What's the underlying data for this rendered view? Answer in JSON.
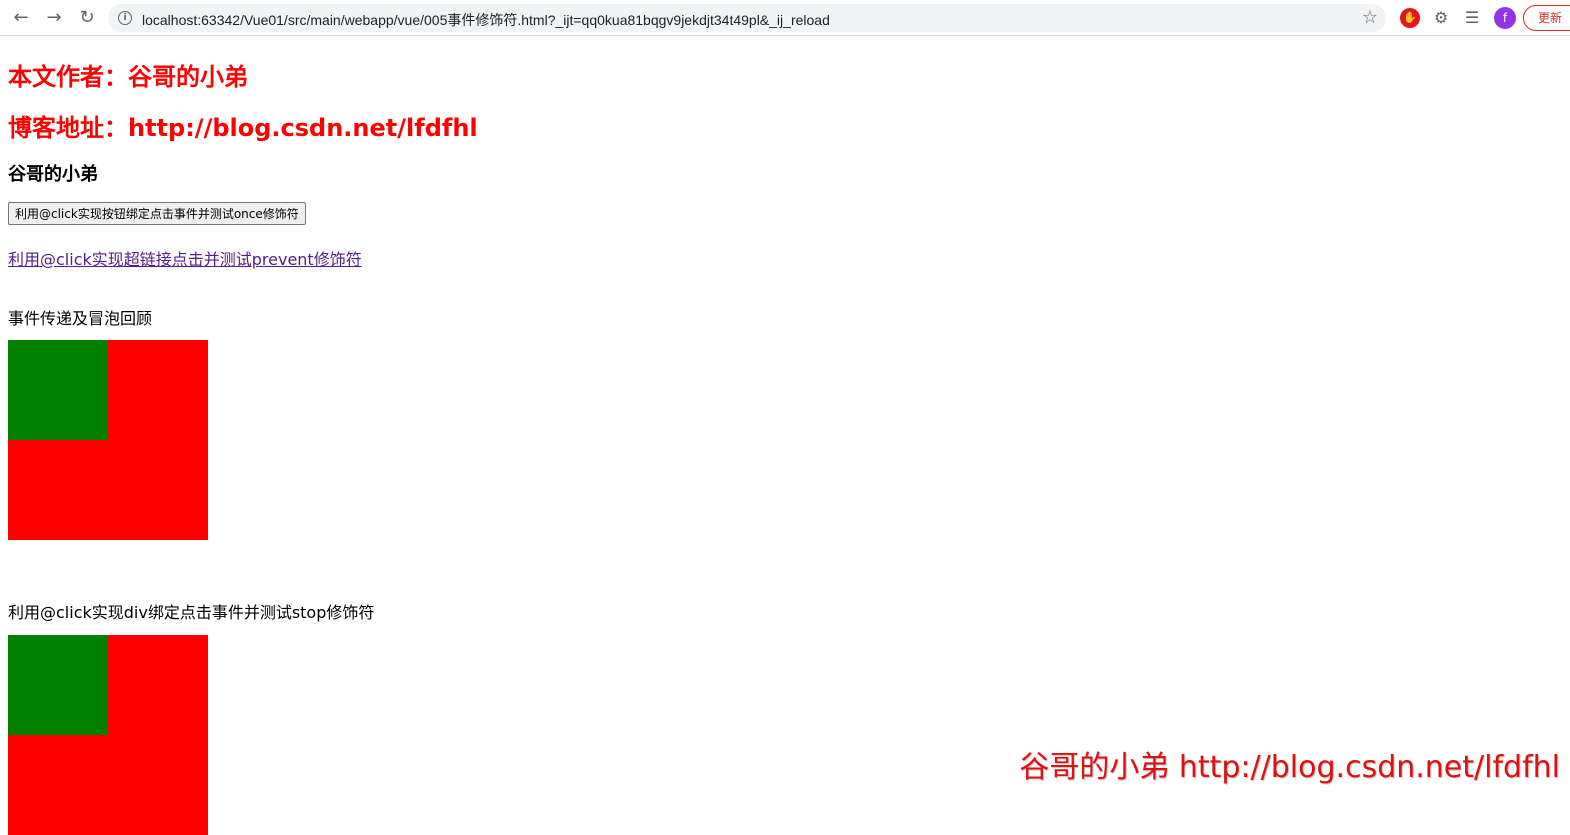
{
  "browser": {
    "url": "localhost:63342/Vue01/src/main/webapp/vue/005事件修饰符.html?_ijt=qq0kua81bqgv9jekdjt34t49pl&_ij_reload",
    "update_label": "更新",
    "avatar_letter": "f",
    "icons": {
      "back": "arrow-left-icon",
      "forward": "arrow-right-icon",
      "reload": "reload-icon",
      "info": "info-icon",
      "star": "star-icon",
      "adblock": "adblock-icon",
      "extensions": "puzzle-icon",
      "media": "media-queue-icon"
    }
  },
  "page": {
    "author_heading": "本文作者：谷哥的小弟",
    "blog_heading": "博客地址：http://blog.csdn.net/lfdfhl",
    "subheading": "谷哥的小弟",
    "once_button_label": "利用@click实现按钮绑定点击事件并测试once修饰符",
    "prevent_link_text": "利用@click实现超链接点击并测试prevent修饰符",
    "bubble_label": "事件传递及冒泡回顾",
    "stop_label": "利用@click实现div绑定点击事件并测试stop修饰符",
    "colors": {
      "heading": "#ff0000",
      "outer_box": "#ff0000",
      "inner_box": "#008000",
      "link": "#551a8b"
    }
  },
  "watermark": {
    "text": "谷哥的小弟 http://blog.csdn.net/lfdfhl"
  }
}
